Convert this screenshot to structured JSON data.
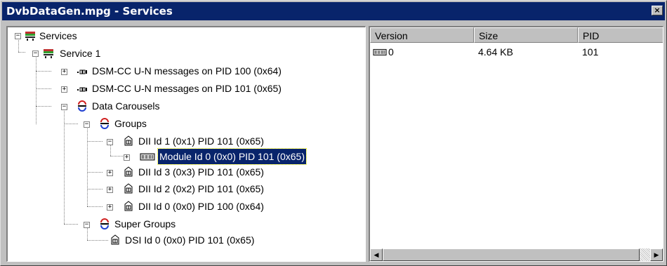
{
  "window": {
    "title": "DvbDataGen.mpg - Services",
    "close_glyph": "×"
  },
  "tree": {
    "nodes": [
      {
        "label": "Services",
        "icon": "services-icon",
        "expander": "−"
      },
      {
        "label": "Service 1",
        "icon": "service-icon",
        "expander": "−"
      },
      {
        "label": "DSM-CC U-N messages on PID 100 (0x64)",
        "icon": "message-stream-icon",
        "expander": "+"
      },
      {
        "label": "DSM-CC U-N messages on PID 101 (0x65)",
        "icon": "message-stream-icon",
        "expander": "+"
      },
      {
        "label": "Data Carousels",
        "icon": "carousel-icon",
        "expander": "−"
      },
      {
        "label": "Groups",
        "icon": "carousel-icon",
        "expander": "−"
      },
      {
        "label": "DII Id 1 (0x1) PID 101 (0x65)",
        "icon": "dii-icon",
        "expander": "−"
      },
      {
        "label": "Module Id 0 (0x0) PID 101 (0x65)",
        "icon": "module-icon",
        "expander": "+",
        "selected": true
      },
      {
        "label": "DII Id 3 (0x3) PID 101 (0x65)",
        "icon": "dii-icon",
        "expander": "+"
      },
      {
        "label": "DII Id 2 (0x2) PID 101 (0x65)",
        "icon": "dii-icon",
        "expander": "+"
      },
      {
        "label": "DII Id 0 (0x0) PID 100 (0x64)",
        "icon": "dii-icon",
        "expander": "+"
      },
      {
        "label": "Super Groups",
        "icon": "carousel-icon",
        "expander": "−"
      },
      {
        "label": "DSI Id 0 (0x0) PID 101 (0x65)",
        "icon": "dii-icon"
      }
    ]
  },
  "list": {
    "columns": [
      "Version",
      "Size",
      "PID"
    ],
    "rows": [
      {
        "version": "0",
        "size": "4.64 KB",
        "pid": "101",
        "icon": "module-icon"
      }
    ]
  },
  "scrollbar": {
    "left_arrow": "◀",
    "right_arrow": "▶"
  },
  "colors": {
    "title_bg": "#08246b",
    "selection_bg": "#08246b",
    "chrome": "#c0c0c0"
  }
}
